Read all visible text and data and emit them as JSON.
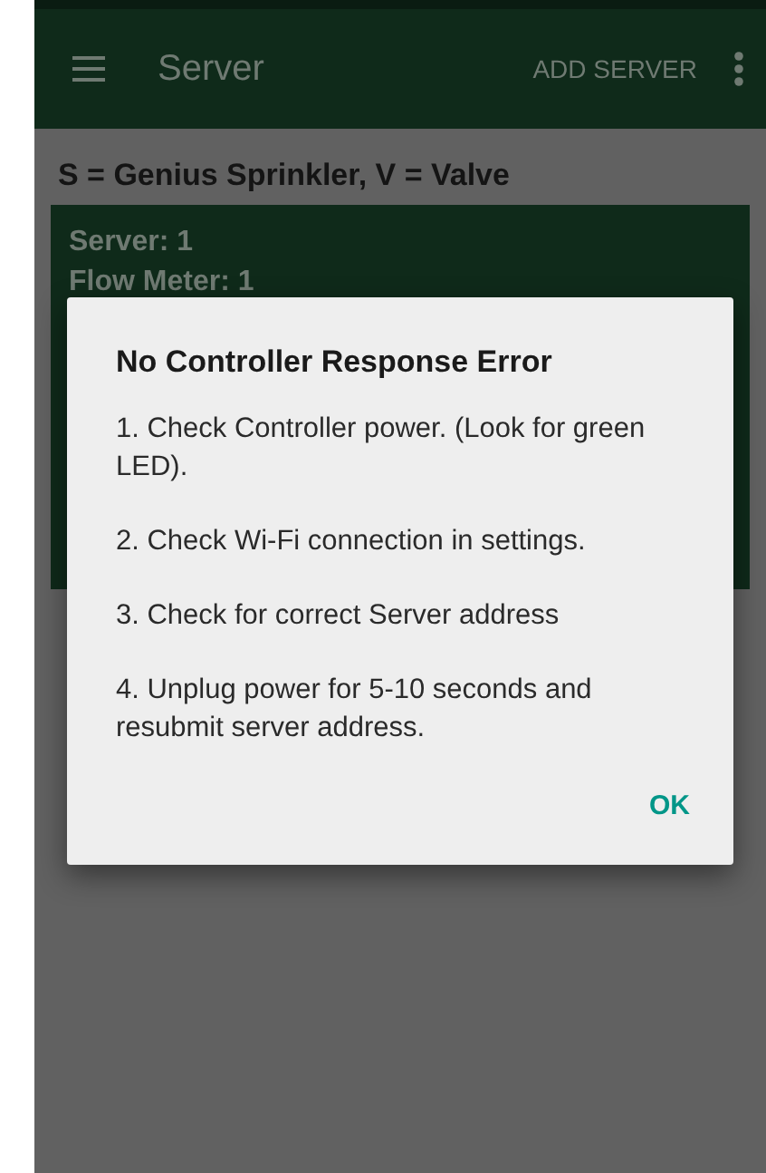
{
  "app_bar": {
    "title": "Server",
    "action": "ADD SERVER"
  },
  "legend": "S = Genius Sprinkler, V = Valve",
  "server_card": {
    "lines": [
      "Server: 1",
      "Flow Meter: 1"
    ]
  },
  "dialog": {
    "title": "No Controller Response Error",
    "items": [
      "1. Check Controller power. (Look for green LED).",
      "2. Check Wi-Fi connection in settings.",
      "3. Check for correct Server address",
      "4. Unplug power for 5-10 seconds and resubmit server address."
    ],
    "button": "OK"
  }
}
